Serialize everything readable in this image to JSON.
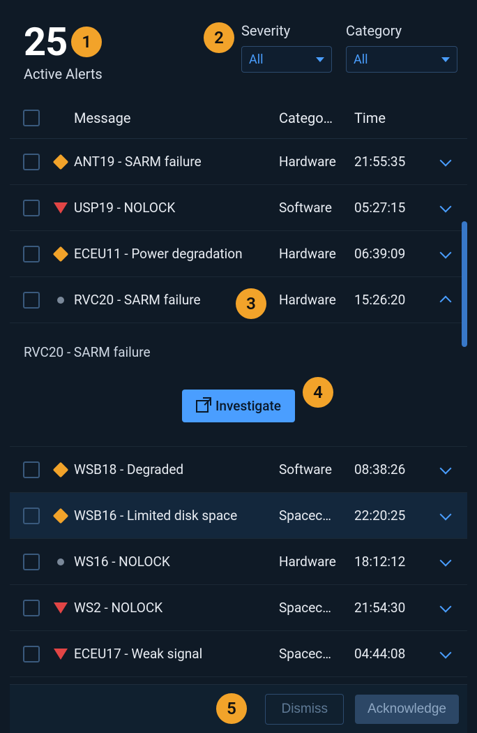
{
  "header": {
    "active_count": "25",
    "active_label": "Active Alerts",
    "severity_label": "Severity",
    "severity_value": "All",
    "category_label": "Category",
    "category_value": "All"
  },
  "columns": {
    "message": "Message",
    "category": "Catego…",
    "time": "Time"
  },
  "rows": [
    {
      "severity": "caution",
      "message": "ANT19 - SARM failure",
      "category": "Hardware",
      "time": "21:55:35",
      "expanded": false
    },
    {
      "severity": "critical",
      "message": "USP19 - NOLOCK",
      "category": "Software",
      "time": "05:27:15",
      "expanded": false
    },
    {
      "severity": "caution",
      "message": "ECEU11 - Power degradation",
      "category": "Hardware",
      "time": "06:39:09",
      "expanded": false
    },
    {
      "severity": "standby",
      "message": "RVC20 - SARM failure",
      "category": "Hardware",
      "time": "15:26:20",
      "expanded": true,
      "detail_title": "RVC20 - SARM failure",
      "investigate_label": "Investigate"
    },
    {
      "severity": "caution",
      "message": "WSB18 - Degraded",
      "category": "Software",
      "time": "08:38:26",
      "expanded": false
    },
    {
      "severity": "caution",
      "message": "WSB16 - Limited disk space",
      "category": "Spacec…",
      "time": "22:20:25",
      "expanded": false,
      "hover": true
    },
    {
      "severity": "standby",
      "message": "WS16 - NOLOCK",
      "category": "Hardware",
      "time": "18:12:12",
      "expanded": false
    },
    {
      "severity": "critical",
      "message": "WS2 - NOLOCK",
      "category": "Spacec…",
      "time": "21:54:30",
      "expanded": false
    },
    {
      "severity": "critical",
      "message": "ECEU17 - Weak signal",
      "category": "Spacec…",
      "time": "04:44:08",
      "expanded": false
    }
  ],
  "footer": {
    "dismiss_label": "Dismiss",
    "acknowledge_label": "Acknowledge"
  },
  "badges": {
    "b1": "1",
    "b2": "2",
    "b3": "3",
    "b4": "4",
    "b5": "5"
  }
}
